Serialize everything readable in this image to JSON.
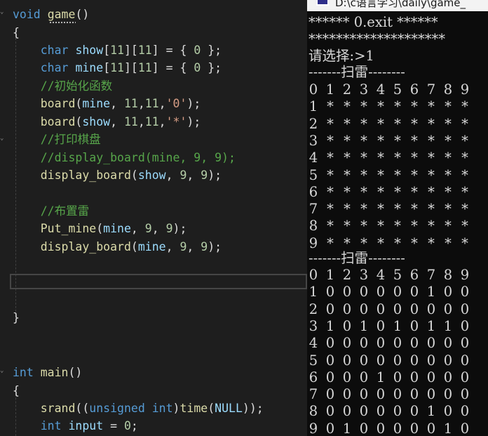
{
  "editor": {
    "lines": [
      [
        [
          "kw",
          "void"
        ],
        [
          "pl",
          " "
        ],
        [
          "fn",
          "game"
        ],
        [
          "pl",
          "()"
        ]
      ],
      [
        [
          "pl",
          "{"
        ]
      ],
      [
        [
          "pl",
          "    "
        ],
        [
          "kw",
          "char"
        ],
        [
          "pl",
          " "
        ],
        [
          "var",
          "show"
        ],
        [
          "pl",
          "["
        ],
        [
          "num",
          "11"
        ],
        [
          "pl",
          "]["
        ],
        [
          "num",
          "11"
        ],
        [
          "pl",
          "] = { "
        ],
        [
          "num",
          "0"
        ],
        [
          "pl",
          " };"
        ]
      ],
      [
        [
          "pl",
          "    "
        ],
        [
          "kw",
          "char"
        ],
        [
          "pl",
          " "
        ],
        [
          "var",
          "mine"
        ],
        [
          "pl",
          "["
        ],
        [
          "num",
          "11"
        ],
        [
          "pl",
          "]["
        ],
        [
          "num",
          "11"
        ],
        [
          "pl",
          "] = { "
        ],
        [
          "num",
          "0"
        ],
        [
          "pl",
          " };"
        ]
      ],
      [
        [
          "pl",
          "    "
        ],
        [
          "cmt",
          "//初始化函数"
        ]
      ],
      [
        [
          "pl",
          "    "
        ],
        [
          "fn",
          "board"
        ],
        [
          "pl",
          "("
        ],
        [
          "var",
          "mine"
        ],
        [
          "pl",
          ", "
        ],
        [
          "num",
          "11"
        ],
        [
          "pl",
          ","
        ],
        [
          "num",
          "11"
        ],
        [
          "pl",
          ","
        ],
        [
          "str",
          "'0'"
        ],
        [
          "pl",
          ");"
        ]
      ],
      [
        [
          "pl",
          "    "
        ],
        [
          "fn",
          "board"
        ],
        [
          "pl",
          "("
        ],
        [
          "var",
          "show"
        ],
        [
          "pl",
          ", "
        ],
        [
          "num",
          "11"
        ],
        [
          "pl",
          ","
        ],
        [
          "num",
          "11"
        ],
        [
          "pl",
          ","
        ],
        [
          "str",
          "'*'"
        ],
        [
          "pl",
          ");"
        ]
      ],
      [
        [
          "pl",
          "    "
        ],
        [
          "cmt",
          "//打印棋盘"
        ]
      ],
      [
        [
          "pl",
          "    "
        ],
        [
          "cmt-dim",
          "//display_board(mine, 9, 9);"
        ]
      ],
      [
        [
          "pl",
          "    "
        ],
        [
          "fn",
          "display_board"
        ],
        [
          "pl",
          "("
        ],
        [
          "var",
          "show"
        ],
        [
          "pl",
          ", "
        ],
        [
          "num",
          "9"
        ],
        [
          "pl",
          ", "
        ],
        [
          "num",
          "9"
        ],
        [
          "pl",
          ");"
        ]
      ],
      [],
      [
        [
          "pl",
          "    "
        ],
        [
          "cmt",
          "//布置雷"
        ]
      ],
      [
        [
          "pl",
          "    "
        ],
        [
          "fn",
          "Put_mine"
        ],
        [
          "pl",
          "("
        ],
        [
          "var",
          "mine"
        ],
        [
          "pl",
          ", "
        ],
        [
          "num",
          "9"
        ],
        [
          "pl",
          ", "
        ],
        [
          "num",
          "9"
        ],
        [
          "pl",
          ");"
        ]
      ],
      [
        [
          "pl",
          "    "
        ],
        [
          "fn",
          "display_board"
        ],
        [
          "pl",
          "("
        ],
        [
          "var",
          "mine"
        ],
        [
          "pl",
          ", "
        ],
        [
          "num",
          "9"
        ],
        [
          "pl",
          ", "
        ],
        [
          "num",
          "9"
        ],
        [
          "pl",
          ");"
        ]
      ],
      [],
      [],
      [],
      [
        [
          "pl",
          "}"
        ]
      ],
      [],
      [],
      [
        [
          "kw",
          "int"
        ],
        [
          "pl",
          " "
        ],
        [
          "fn",
          "main"
        ],
        [
          "pl",
          "()"
        ]
      ],
      [
        [
          "pl",
          "{"
        ]
      ],
      [
        [
          "pl",
          "    "
        ],
        [
          "fn",
          "srand"
        ],
        [
          "pl",
          "(("
        ],
        [
          "kw",
          "unsigned int"
        ],
        [
          "pl",
          ")"
        ],
        [
          "fn",
          "time"
        ],
        [
          "pl",
          "("
        ],
        [
          "var",
          "NULL"
        ],
        [
          "pl",
          "));"
        ]
      ],
      [
        [
          "pl",
          "    "
        ],
        [
          "kw",
          "int"
        ],
        [
          "pl",
          " "
        ],
        [
          "var",
          "input"
        ],
        [
          "pl",
          " = "
        ],
        [
          "num",
          "0"
        ],
        [
          "pl",
          ";"
        ]
      ]
    ]
  },
  "console": {
    "title": "D:\\c语言学习\\daily\\game_",
    "menu_exit": "****** 0.exit ******",
    "menu_stars": "********************",
    "prompt": "请选择:>1",
    "board1_header": "-------扫雷--------",
    "board1_rows": [
      [
        "0",
        "1",
        "2",
        "3",
        "4",
        "5",
        "6",
        "7",
        "8",
        "9"
      ],
      [
        "1",
        "*",
        "*",
        "*",
        "*",
        "*",
        "*",
        "*",
        "*",
        "*"
      ],
      [
        "2",
        "*",
        "*",
        "*",
        "*",
        "*",
        "*",
        "*",
        "*",
        "*"
      ],
      [
        "3",
        "*",
        "*",
        "*",
        "*",
        "*",
        "*",
        "*",
        "*",
        "*"
      ],
      [
        "4",
        "*",
        "*",
        "*",
        "*",
        "*",
        "*",
        "*",
        "*",
        "*"
      ],
      [
        "5",
        "*",
        "*",
        "*",
        "*",
        "*",
        "*",
        "*",
        "*",
        "*"
      ],
      [
        "6",
        "*",
        "*",
        "*",
        "*",
        "*",
        "*",
        "*",
        "*",
        "*"
      ],
      [
        "7",
        "*",
        "*",
        "*",
        "*",
        "*",
        "*",
        "*",
        "*",
        "*"
      ],
      [
        "8",
        "*",
        "*",
        "*",
        "*",
        "*",
        "*",
        "*",
        "*",
        "*"
      ],
      [
        "9",
        "*",
        "*",
        "*",
        "*",
        "*",
        "*",
        "*",
        "*",
        "*"
      ]
    ],
    "board2_header": "-------扫雷--------",
    "board2_rows": [
      [
        "0",
        "1",
        "2",
        "3",
        "4",
        "5",
        "6",
        "7",
        "8",
        "9"
      ],
      [
        "1",
        "0",
        "0",
        "0",
        "0",
        "0",
        "0",
        "1",
        "0",
        "0"
      ],
      [
        "2",
        "0",
        "0",
        "0",
        "0",
        "0",
        "0",
        "0",
        "0",
        "0"
      ],
      [
        "3",
        "1",
        "0",
        "1",
        "0",
        "1",
        "0",
        "1",
        "1",
        "0"
      ],
      [
        "4",
        "0",
        "0",
        "0",
        "0",
        "0",
        "0",
        "0",
        "0",
        "0"
      ],
      [
        "5",
        "0",
        "0",
        "0",
        "0",
        "0",
        "0",
        "0",
        "0",
        "0"
      ],
      [
        "6",
        "0",
        "0",
        "0",
        "1",
        "0",
        "0",
        "0",
        "0",
        "0"
      ],
      [
        "7",
        "0",
        "0",
        "0",
        "0",
        "0",
        "0",
        "0",
        "0",
        "0"
      ],
      [
        "8",
        "0",
        "0",
        "0",
        "0",
        "0",
        "0",
        "1",
        "0",
        "0"
      ],
      [
        "9",
        "0",
        "1",
        "0",
        "0",
        "0",
        "0",
        "0",
        "1",
        "0"
      ]
    ]
  }
}
